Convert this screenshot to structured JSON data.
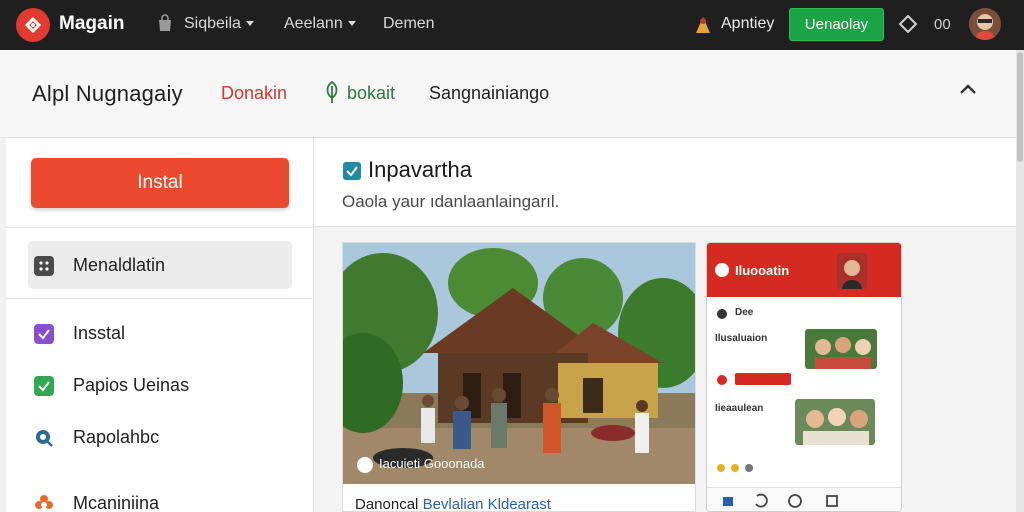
{
  "topbar": {
    "brand": "Magain",
    "nav": [
      {
        "label": "Siqbeila"
      },
      {
        "label": "Aeelann"
      },
      {
        "label": "Demen"
      }
    ],
    "user_name": "Apntiey",
    "cta_label": "Uenaolay",
    "count": "00"
  },
  "header": {
    "title": "Alpl Nugnagaiy",
    "tabs": [
      {
        "label": "Donakin"
      },
      {
        "label": "bokait"
      },
      {
        "label": "Sangnainiango"
      }
    ]
  },
  "sidebar": {
    "install_label": "Instal",
    "items": [
      {
        "label": "Menaldlatin",
        "icon": "grid-icon",
        "color": "#5a5a5a"
      },
      {
        "label": "Insstal",
        "icon": "check-box-icon",
        "color": "#8a4fd0"
      },
      {
        "label": "Papios Ueinas",
        "icon": "check-box-icon",
        "color": "#33a852"
      },
      {
        "label": "Rapolahbc",
        "icon": "search-icon",
        "color": "#2d6c8f"
      },
      {
        "label": "Mcaniniina",
        "icon": "flower-icon",
        "color": "#ea6a2e"
      }
    ]
  },
  "main": {
    "title": "Inpavartha",
    "subtitle": "Oaola yaur ıdanlaanlaingarıl.",
    "photo": {
      "overlay_caption": "Iacuieti Gooonada",
      "caption_prefix": "Danoncal",
      "caption_link": "Bevlalian Kldearast"
    },
    "phone": {
      "title": "Iluooatin",
      "rows": [
        {
          "label": "Dee"
        },
        {
          "label": "Ilusaluaion"
        },
        {
          "label": "Iieaaulean"
        }
      ]
    }
  },
  "colors": {
    "accent_red": "#ec4a2e",
    "accent_green": "#1aa446",
    "topbar_bg": "#1f1f1f"
  }
}
